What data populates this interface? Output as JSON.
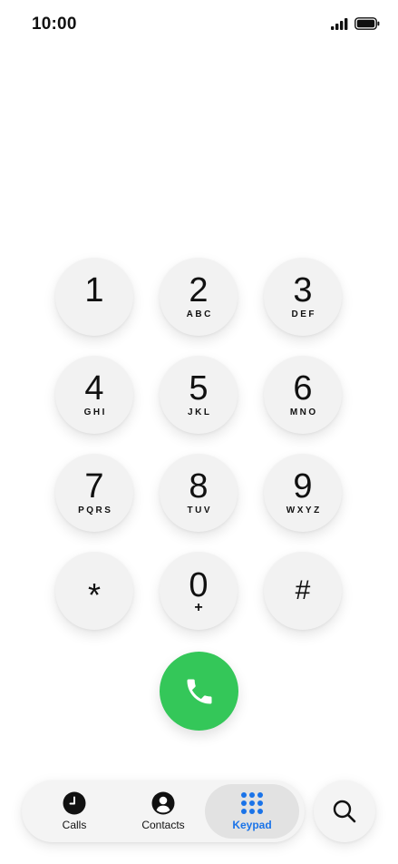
{
  "status_bar": {
    "time": "10:00"
  },
  "keypad": {
    "keys": [
      {
        "digit": "1",
        "letters": ""
      },
      {
        "digit": "2",
        "letters": "ABC"
      },
      {
        "digit": "3",
        "letters": "DEF"
      },
      {
        "digit": "4",
        "letters": "GHI"
      },
      {
        "digit": "5",
        "letters": "JKL"
      },
      {
        "digit": "6",
        "letters": "MNO"
      },
      {
        "digit": "7",
        "letters": "PQRS"
      },
      {
        "digit": "8",
        "letters": "TUV"
      },
      {
        "digit": "9",
        "letters": "WXYZ"
      },
      {
        "digit": "*",
        "letters": ""
      },
      {
        "digit": "0",
        "letters": "+"
      },
      {
        "digit": "#",
        "letters": ""
      }
    ]
  },
  "tabs": [
    {
      "label": "Calls",
      "icon": "clock-icon",
      "active": false
    },
    {
      "label": "Contacts",
      "icon": "person-icon",
      "active": false
    },
    {
      "label": "Keypad",
      "icon": "keypad-grid-icon",
      "active": true
    }
  ],
  "colors": {
    "call_green": "#34c759",
    "active_tab_text": "#1a73e8",
    "key_background": "#f2f2f2"
  },
  "icons": {
    "call": "phone-icon",
    "search": "search-icon",
    "signal": "signal-bars-icon",
    "battery": "battery-icon"
  }
}
